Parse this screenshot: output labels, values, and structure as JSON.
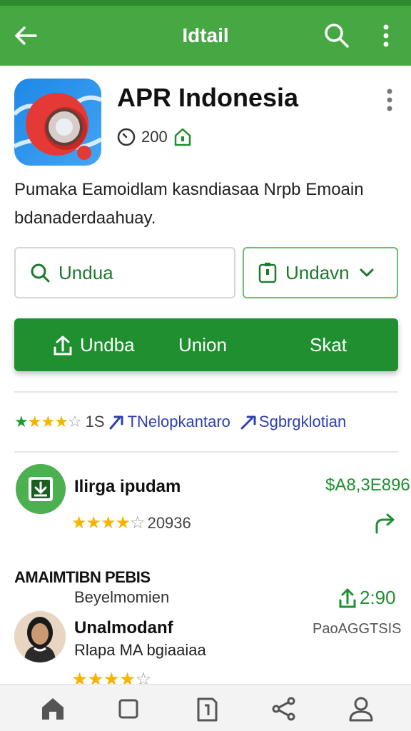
{
  "appbar": {
    "title": "Idtail",
    "icons": {
      "back": "back-arrow-icon",
      "search": "search-icon",
      "more": "more-vert-icon"
    }
  },
  "app": {
    "name": "APR Indonesia",
    "meta_value": "200",
    "description": "Pumaka Eamoidlam kasndiasaa Nrpb Emoain bdanaderdaahuay."
  },
  "buttons": {
    "outline_left": "Undua",
    "outline_right": "Undavn",
    "primary": [
      "Undba",
      "Union",
      "Skat"
    ]
  },
  "rating_row": {
    "stars": 4,
    "count": "1S",
    "link1": "TNelopkantaro",
    "link2": "Sgbrgklotian"
  },
  "related": {
    "title": "Ilirga ipudam",
    "price": "$A8,3E896",
    "stars": 4,
    "count": "20936"
  },
  "section": {
    "title": "AMAIMTIBN PEBIS",
    "subtitle": "Beyelmomien",
    "meta": "2:90"
  },
  "review": {
    "name": "Unalmodanf",
    "tag": "PaoAGGTSIS",
    "text": "Rlapa MA bgiaaiaa",
    "stars": 4
  },
  "bottom_nav": [
    "home-icon",
    "square-icon",
    "document-icon",
    "share-nav-icon",
    "profile-icon"
  ],
  "colors": {
    "primary": "#45a842",
    "primary_dark": "#1f8f2f",
    "star": "#f5b400",
    "link": "#2e3fb0"
  }
}
